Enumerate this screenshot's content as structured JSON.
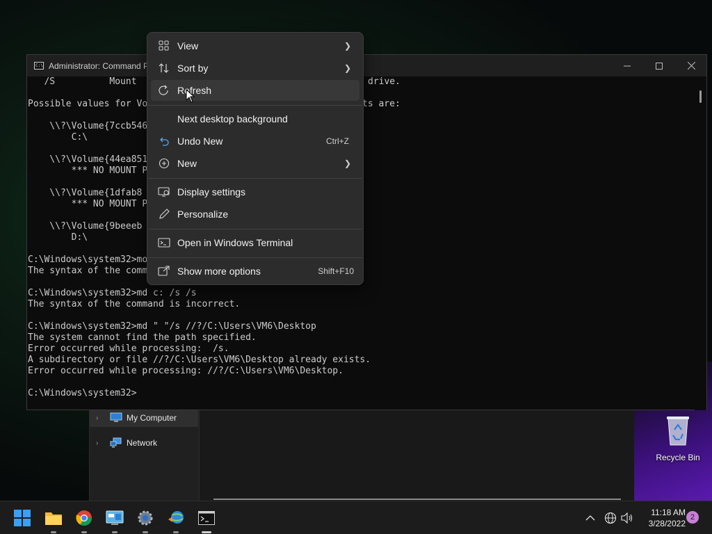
{
  "cmd_window": {
    "title": "Administrator: Command P",
    "lines": [
      "   /S          Mount",
      "",
      "Possible values for Vo",
      "",
      "    \\\\?\\Volume{7ccb546",
      "        C:\\",
      "",
      "    \\\\?\\Volume{44ea851",
      "        *** NO MOUNT P",
      "",
      "    \\\\?\\Volume{1dfab8",
      "        *** NO MOUNT P",
      "",
      "    \\\\?\\Volume{9beeeb",
      "        D:\\",
      "",
      "C:\\Windows\\system32>mo",
      "The syntax of the comm",
      "",
      "C:\\Windows\\system32>md c: /s /s",
      "The syntax of the command is incorrect.",
      "",
      "C:\\Windows\\system32>md \" \"/s //?/C:\\Users\\VM6\\Desktop",
      "The system cannot find the path specified.",
      "Error occurred while processing:  /s.",
      "A subdirectory or file //?/C:\\Users\\VM6\\Desktop already exists.",
      "Error occurred while processing: //?/C:\\Users\\VM6\\Desktop.",
      "",
      "C:\\Windows\\system32>"
    ],
    "right_fragment_1": "drive.",
    "right_fragment_2": "ts are:"
  },
  "context_menu": {
    "items": [
      {
        "label": "View",
        "icon": "grid-icon",
        "submenu": true
      },
      {
        "label": "Sort by",
        "icon": "sort-icon",
        "submenu": true
      },
      {
        "label": "Refresh",
        "icon": "refresh-icon"
      },
      {
        "label": "Next desktop background",
        "icon": ""
      },
      {
        "label": "Undo New",
        "icon": "undo-icon",
        "shortcut": "Ctrl+Z"
      },
      {
        "label": "New",
        "icon": "plus-circle-icon",
        "submenu": true
      },
      {
        "label": "Display settings",
        "icon": "display-icon"
      },
      {
        "label": "Personalize",
        "icon": "pen-icon"
      },
      {
        "label": "Open in Windows Terminal",
        "icon": "terminal-icon"
      },
      {
        "label": "Show more options",
        "icon": "share-icon",
        "shortcut": "Shift+F10"
      }
    ]
  },
  "explorer": {
    "nav_items": [
      "My Computer",
      "Network"
    ]
  },
  "desktop": {
    "recycle_bin_label": "Recycle Bin"
  },
  "taskbar": {
    "apps": [
      "start-icon",
      "file-explorer-icon",
      "chrome-icon",
      "control-panel-icon",
      "settings-icon",
      "network-app-icon",
      "terminal-icon"
    ],
    "time": "11:18 AM",
    "date": "3/28/2022",
    "notification_count": "2"
  },
  "colors": {
    "menu_bg": "#2c2c2c",
    "console_bg": "#0c0c0c",
    "taskbar_bg": "#1c1c1c",
    "notification_badge": "#c77fd6"
  }
}
